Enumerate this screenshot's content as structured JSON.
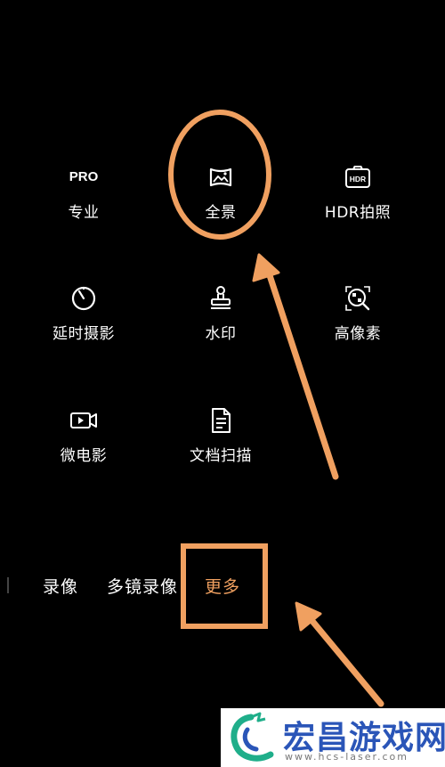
{
  "modes": [
    {
      "label": "专业",
      "icon": "pro-badge-icon",
      "icon_text": "PRO"
    },
    {
      "label": "全景",
      "icon": "panorama-icon"
    },
    {
      "label": "HDR拍照",
      "icon": "hdr-icon",
      "icon_text": "HDR"
    },
    {
      "label": "延时摄影",
      "icon": "timelapse-icon"
    },
    {
      "label": "水印",
      "icon": "stamp-icon"
    },
    {
      "label": "高像素",
      "icon": "high-resolution-icon"
    },
    {
      "label": "微电影",
      "icon": "video-camera-icon"
    },
    {
      "label": "文档扫描",
      "icon": "document-icon"
    }
  ],
  "bottom_tabs": [
    "录像",
    "多镜录像",
    "更多"
  ],
  "selected_tab": "更多",
  "annotation_color": "#f0a060",
  "watermark": {
    "name": "宏昌游戏网",
    "url": "www.hcs-laser.com"
  }
}
